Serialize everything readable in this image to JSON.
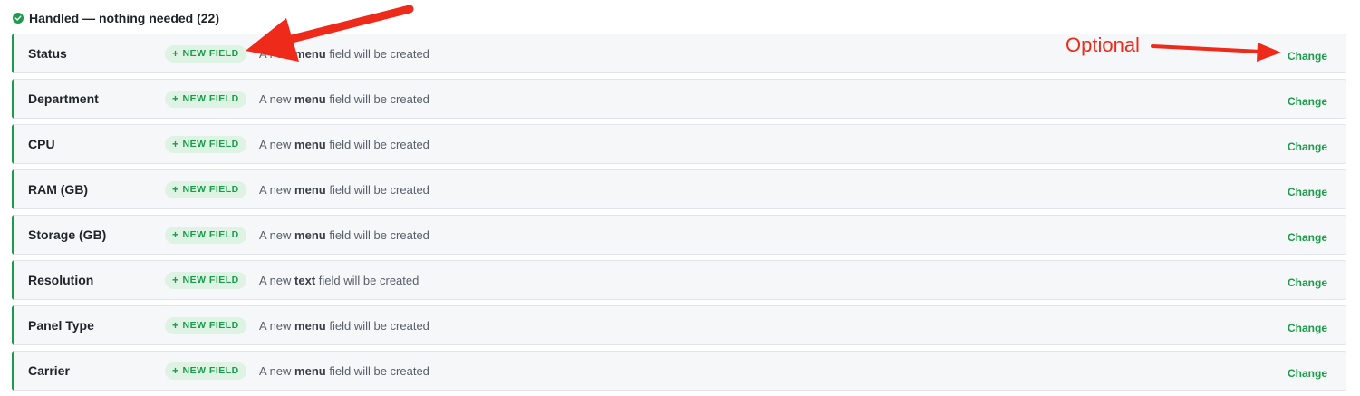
{
  "section": {
    "title": "Handled — nothing needed (22)"
  },
  "rows": [
    {
      "name": "Status",
      "badge": "NEW FIELD",
      "prefix": "A new",
      "type": "menu",
      "suffix": "field will be created",
      "action": "Change"
    },
    {
      "name": "Department",
      "badge": "NEW FIELD",
      "prefix": "A new",
      "type": "menu",
      "suffix": "field will be created",
      "action": "Change"
    },
    {
      "name": "CPU",
      "badge": "NEW FIELD",
      "prefix": "A new",
      "type": "menu",
      "suffix": "field will be created",
      "action": "Change"
    },
    {
      "name": "RAM (GB)",
      "badge": "NEW FIELD",
      "prefix": "A new",
      "type": "menu",
      "suffix": "field will be created",
      "action": "Change"
    },
    {
      "name": "Storage (GB)",
      "badge": "NEW FIELD",
      "prefix": "A new",
      "type": "menu",
      "suffix": "field will be created",
      "action": "Change"
    },
    {
      "name": "Resolution",
      "badge": "NEW FIELD",
      "prefix": "A new",
      "type": "text",
      "suffix": "field will be created",
      "action": "Change"
    },
    {
      "name": "Panel Type",
      "badge": "NEW FIELD",
      "prefix": "A new",
      "type": "menu",
      "suffix": "field will be created",
      "action": "Change"
    },
    {
      "name": "Carrier",
      "badge": "NEW FIELD",
      "prefix": "A new",
      "type": "menu",
      "suffix": "field will be created",
      "action": "Change"
    }
  ],
  "annotation": {
    "label": "Optional",
    "color": "#ee2a1a"
  },
  "colors": {
    "accent": "#1a9c4a",
    "badge_bg": "#dff3e5",
    "row_bg": "#f6f7f9"
  }
}
